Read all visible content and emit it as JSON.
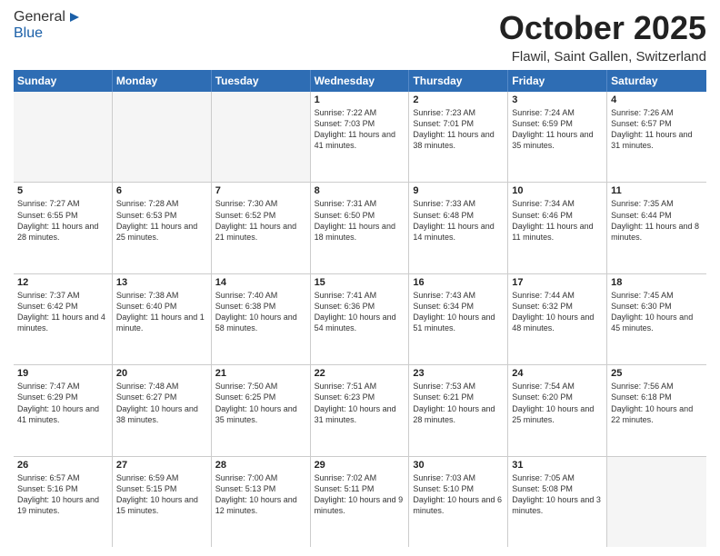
{
  "header": {
    "logo_general": "General",
    "logo_blue": "Blue",
    "month_title": "October 2025",
    "location": "Flawil, Saint Gallen, Switzerland"
  },
  "weekdays": [
    "Sunday",
    "Monday",
    "Tuesday",
    "Wednesday",
    "Thursday",
    "Friday",
    "Saturday"
  ],
  "rows": [
    [
      {
        "day": "",
        "empty": true
      },
      {
        "day": "",
        "empty": true
      },
      {
        "day": "",
        "empty": true
      },
      {
        "day": "1",
        "sunrise": "7:22 AM",
        "sunset": "7:03 PM",
        "daylight": "11 hours and 41 minutes."
      },
      {
        "day": "2",
        "sunrise": "7:23 AM",
        "sunset": "7:01 PM",
        "daylight": "11 hours and 38 minutes."
      },
      {
        "day": "3",
        "sunrise": "7:24 AM",
        "sunset": "6:59 PM",
        "daylight": "11 hours and 35 minutes."
      },
      {
        "day": "4",
        "sunrise": "7:26 AM",
        "sunset": "6:57 PM",
        "daylight": "11 hours and 31 minutes."
      }
    ],
    [
      {
        "day": "5",
        "sunrise": "7:27 AM",
        "sunset": "6:55 PM",
        "daylight": "11 hours and 28 minutes."
      },
      {
        "day": "6",
        "sunrise": "7:28 AM",
        "sunset": "6:53 PM",
        "daylight": "11 hours and 25 minutes."
      },
      {
        "day": "7",
        "sunrise": "7:30 AM",
        "sunset": "6:52 PM",
        "daylight": "11 hours and 21 minutes."
      },
      {
        "day": "8",
        "sunrise": "7:31 AM",
        "sunset": "6:50 PM",
        "daylight": "11 hours and 18 minutes."
      },
      {
        "day": "9",
        "sunrise": "7:33 AM",
        "sunset": "6:48 PM",
        "daylight": "11 hours and 14 minutes."
      },
      {
        "day": "10",
        "sunrise": "7:34 AM",
        "sunset": "6:46 PM",
        "daylight": "11 hours and 11 minutes."
      },
      {
        "day": "11",
        "sunrise": "7:35 AM",
        "sunset": "6:44 PM",
        "daylight": "11 hours and 8 minutes."
      }
    ],
    [
      {
        "day": "12",
        "sunrise": "7:37 AM",
        "sunset": "6:42 PM",
        "daylight": "11 hours and 4 minutes."
      },
      {
        "day": "13",
        "sunrise": "7:38 AM",
        "sunset": "6:40 PM",
        "daylight": "11 hours and 1 minute."
      },
      {
        "day": "14",
        "sunrise": "7:40 AM",
        "sunset": "6:38 PM",
        "daylight": "10 hours and 58 minutes."
      },
      {
        "day": "15",
        "sunrise": "7:41 AM",
        "sunset": "6:36 PM",
        "daylight": "10 hours and 54 minutes."
      },
      {
        "day": "16",
        "sunrise": "7:43 AM",
        "sunset": "6:34 PM",
        "daylight": "10 hours and 51 minutes."
      },
      {
        "day": "17",
        "sunrise": "7:44 AM",
        "sunset": "6:32 PM",
        "daylight": "10 hours and 48 minutes."
      },
      {
        "day": "18",
        "sunrise": "7:45 AM",
        "sunset": "6:30 PM",
        "daylight": "10 hours and 45 minutes."
      }
    ],
    [
      {
        "day": "19",
        "sunrise": "7:47 AM",
        "sunset": "6:29 PM",
        "daylight": "10 hours and 41 minutes."
      },
      {
        "day": "20",
        "sunrise": "7:48 AM",
        "sunset": "6:27 PM",
        "daylight": "10 hours and 38 minutes."
      },
      {
        "day": "21",
        "sunrise": "7:50 AM",
        "sunset": "6:25 PM",
        "daylight": "10 hours and 35 minutes."
      },
      {
        "day": "22",
        "sunrise": "7:51 AM",
        "sunset": "6:23 PM",
        "daylight": "10 hours and 31 minutes."
      },
      {
        "day": "23",
        "sunrise": "7:53 AM",
        "sunset": "6:21 PM",
        "daylight": "10 hours and 28 minutes."
      },
      {
        "day": "24",
        "sunrise": "7:54 AM",
        "sunset": "6:20 PM",
        "daylight": "10 hours and 25 minutes."
      },
      {
        "day": "25",
        "sunrise": "7:56 AM",
        "sunset": "6:18 PM",
        "daylight": "10 hours and 22 minutes."
      }
    ],
    [
      {
        "day": "26",
        "sunrise": "6:57 AM",
        "sunset": "5:16 PM",
        "daylight": "10 hours and 19 minutes."
      },
      {
        "day": "27",
        "sunrise": "6:59 AM",
        "sunset": "5:15 PM",
        "daylight": "10 hours and 15 minutes."
      },
      {
        "day": "28",
        "sunrise": "7:00 AM",
        "sunset": "5:13 PM",
        "daylight": "10 hours and 12 minutes."
      },
      {
        "day": "29",
        "sunrise": "7:02 AM",
        "sunset": "5:11 PM",
        "daylight": "10 hours and 9 minutes."
      },
      {
        "day": "30",
        "sunrise": "7:03 AM",
        "sunset": "5:10 PM",
        "daylight": "10 hours and 6 minutes."
      },
      {
        "day": "31",
        "sunrise": "7:05 AM",
        "sunset": "5:08 PM",
        "daylight": "10 hours and 3 minutes."
      },
      {
        "day": "",
        "empty": true
      }
    ]
  ]
}
